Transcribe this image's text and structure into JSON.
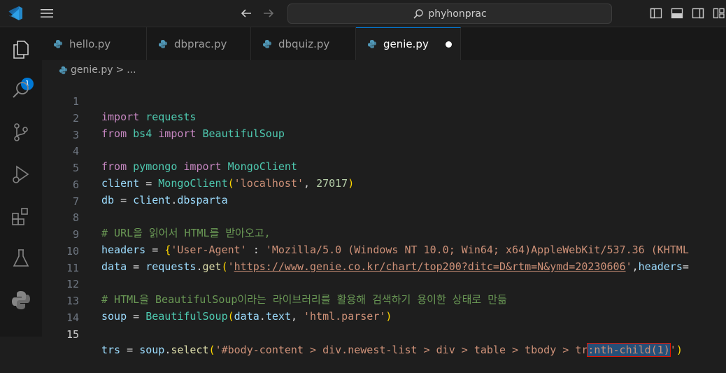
{
  "titlebar": {
    "search_text": "phyhonprac"
  },
  "activity": {
    "explorer_badge": "1"
  },
  "tabs": [
    {
      "label": "hello.py"
    },
    {
      "label": "dbprac.py"
    },
    {
      "label": "dbquiz.py"
    },
    {
      "label": "genie.py"
    }
  ],
  "breadcrumb": {
    "file": "genie.py",
    "sep": ">",
    "rest": "..."
  },
  "lines": {
    "l1": {
      "a": "import",
      "b": "requests"
    },
    "l2": {
      "a": "from",
      "b": "bs4",
      "c": "import",
      "d": "BeautifulSoup"
    },
    "l4": {
      "a": "from",
      "b": "pymongo",
      "c": "import",
      "d": "MongoClient"
    },
    "l5": {
      "a": "client",
      "b": " = ",
      "c": "MongoClient",
      "d": "(",
      "e": "'localhost'",
      "f": ", ",
      "g": "27017",
      "h": ")"
    },
    "l6": {
      "a": "db",
      "b": " = ",
      "c": "client",
      "d": ".",
      "e": "dbsparta"
    },
    "l8": {
      "a": "# URL을 읽어서 HTML를 받아오고,"
    },
    "l9": {
      "a": "headers",
      "b": " = ",
      "c": "{",
      "d": "'User-Agent'",
      "e": " : ",
      "f": "'Mozilla/5.0 (Windows NT 10.0; Win64; x64)AppleWebKit/537.36 (KHTML"
    },
    "l10": {
      "a": "data",
      "b": " = ",
      "c": "requests",
      "d": ".",
      "e": "get",
      "f": "(",
      "g": "'",
      "h": "https://www.genie.co.kr/chart/top200?ditc=D&rtm=N&ymd=20230606",
      "i": "'",
      "j": ",",
      "k": "headers",
      "l": "="
    },
    "l12": {
      "a": "# HTML을 BeautifulSoup이라는 라이브러리를 활용해 검색하기 용이한 상태로 만듦"
    },
    "l13": {
      "a": "soup",
      "b": " = ",
      "c": "BeautifulSoup",
      "d": "(",
      "e": "data",
      "f": ".",
      "g": "text",
      "h": ", ",
      "i": "'html.parser'",
      "j": ")"
    },
    "l15": {
      "a": "trs",
      "b": " = ",
      "c": "soup",
      "d": ".",
      "e": "select",
      "f": "(",
      "g": "'#body-content > div.newest-list > div > table > tbody > tr",
      "h": ":nth-child(1)",
      "i": "'",
      "j": ")"
    }
  },
  "line_numbers": [
    "1",
    "2",
    "3",
    "4",
    "5",
    "6",
    "7",
    "8",
    "9",
    "10",
    "11",
    "12",
    "13",
    "14",
    "15"
  ]
}
